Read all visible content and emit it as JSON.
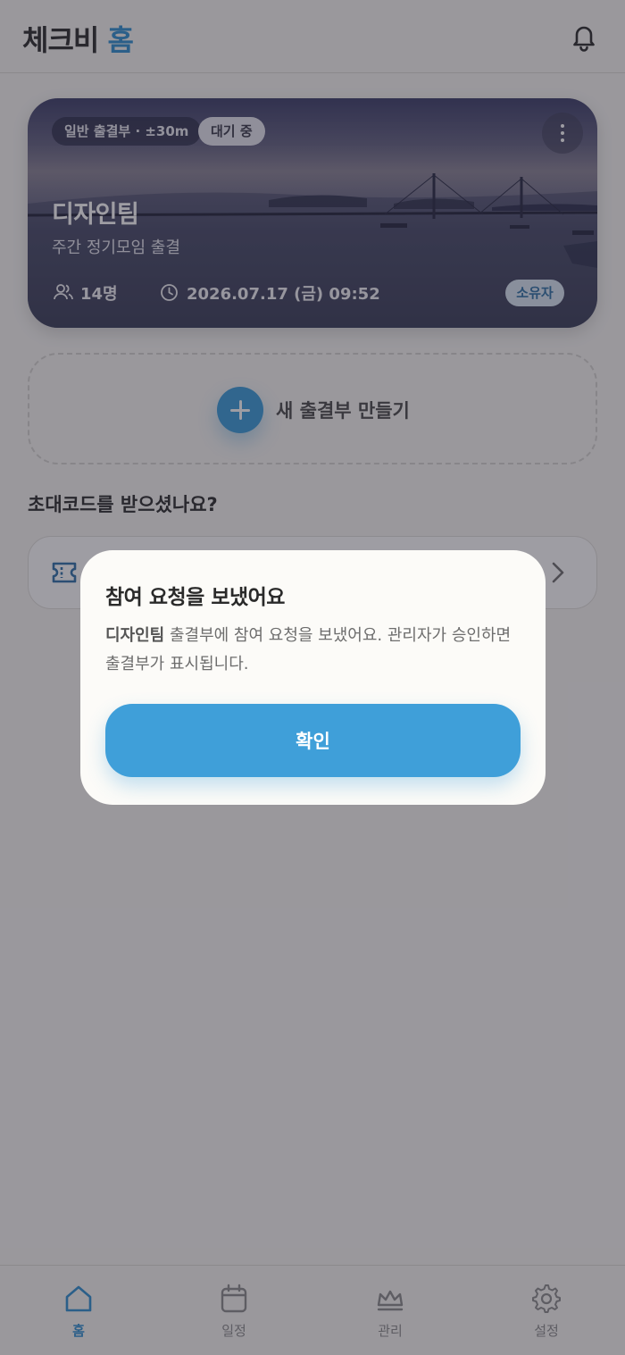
{
  "header": {
    "title_prefix": "체크비",
    "title_accent": "홈"
  },
  "card": {
    "type_chip": "일반 출결부 · ±30m",
    "status_chip": "대기 중",
    "title": "디자인팀",
    "subtitle": "주간 정기모임 출결",
    "members": "14명",
    "datetime": "2026.07.17 (금) 09:52",
    "role_badge": "소유자"
  },
  "new_attendance": {
    "label": "새 출결부 만들기"
  },
  "invite": {
    "heading": "초대코드를 받으셨나요?"
  },
  "nav": {
    "items": [
      {
        "label": "홈",
        "icon": "home-icon",
        "active": true
      },
      {
        "label": "일정",
        "icon": "calendar-icon",
        "active": false
      },
      {
        "label": "관리",
        "icon": "crown-icon",
        "active": false
      },
      {
        "label": "설정",
        "icon": "gear-icon",
        "active": false
      }
    ]
  },
  "modal": {
    "title": "참여 요청을 보냈어요",
    "body_bold": "디자인팀",
    "body_text": " 출결부에 참여 요청을 보냈어요. 관리자가 승인하면 출결부가 표시됩니다.",
    "confirm_label": "확인"
  },
  "colors": {
    "accent": "#3f9fd9",
    "brand": "#2f8ecf"
  }
}
